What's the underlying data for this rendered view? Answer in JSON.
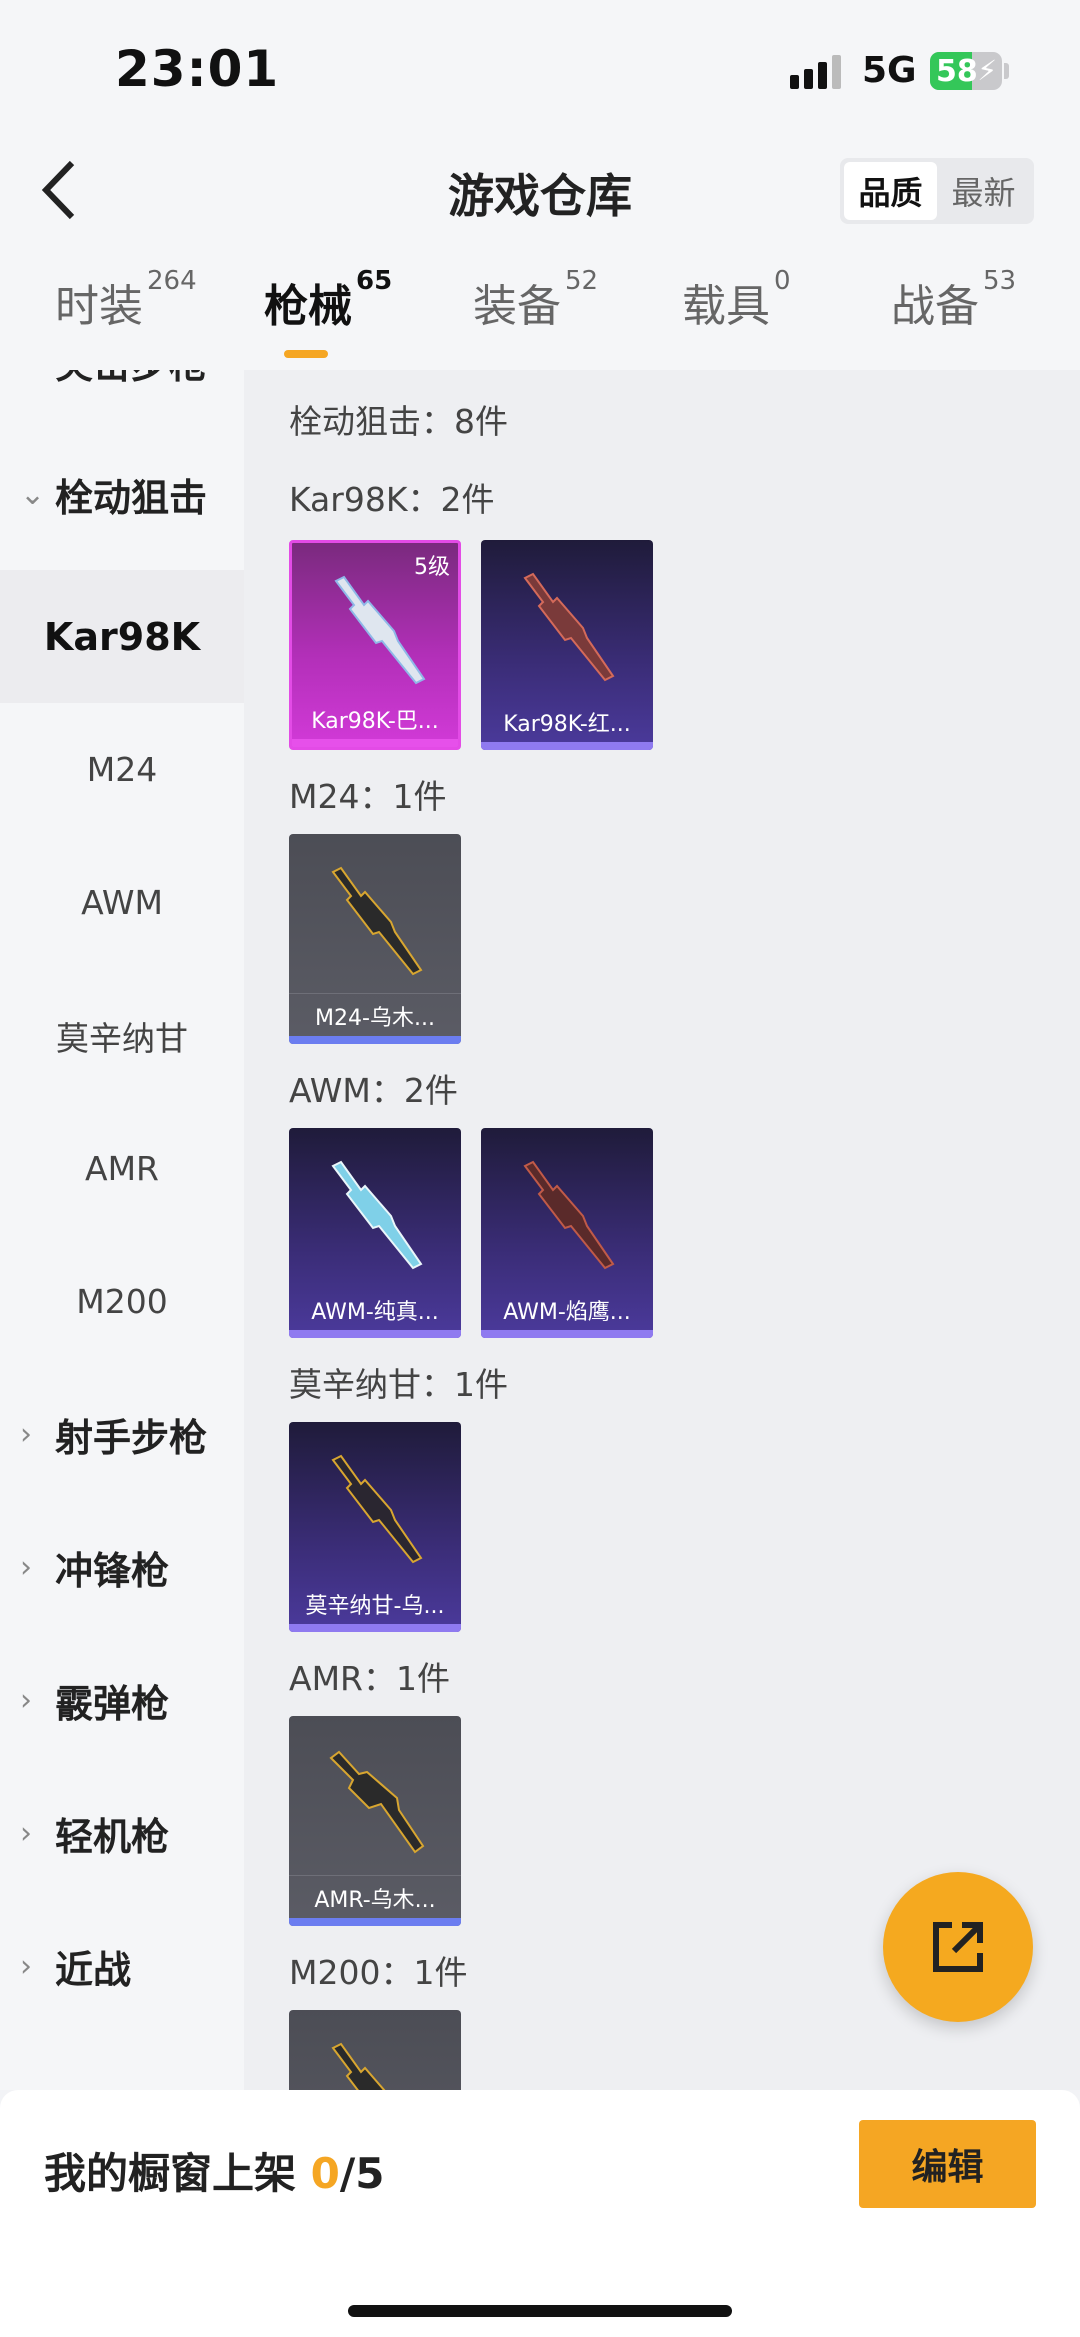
{
  "status_bar": {
    "time": "23:01",
    "network": "5G",
    "battery": "58"
  },
  "header": {
    "title": "游戏仓库",
    "sort_options": [
      "品质",
      "最新"
    ],
    "tabs": [
      {
        "label": "时装",
        "count": "264"
      },
      {
        "label": "枪械",
        "count": "65"
      },
      {
        "label": "装备",
        "count": "52"
      },
      {
        "label": "载具",
        "count": "0"
      },
      {
        "label": "战备",
        "count": "53"
      }
    ]
  },
  "sidebar": {
    "items": [
      {
        "label": "突击步枪",
        "type": "group"
      },
      {
        "label": "栓动狙击",
        "type": "group-open"
      },
      {
        "label": "Kar98K",
        "type": "sub-selected"
      },
      {
        "label": "M24",
        "type": "sub"
      },
      {
        "label": "AWM",
        "type": "sub"
      },
      {
        "label": "莫辛纳甘",
        "type": "sub"
      },
      {
        "label": "AMR",
        "type": "sub"
      },
      {
        "label": "M200",
        "type": "sub"
      },
      {
        "label": "射手步枪",
        "type": "group"
      },
      {
        "label": "冲锋枪",
        "type": "group"
      },
      {
        "label": "霰弹枪",
        "type": "group"
      },
      {
        "label": "轻机枪",
        "type": "group"
      },
      {
        "label": "近战",
        "type": "group"
      }
    ]
  },
  "content": {
    "summary": "栓动狙击：8件",
    "sections": [
      {
        "label": "Kar98K：2件",
        "items": [
          {
            "name": "Kar98K-巴...",
            "level": "5级"
          },
          {
            "name": "Kar98K-红..."
          }
        ]
      },
      {
        "label": "M24：1件",
        "items": [
          {
            "name": "M24-乌木..."
          }
        ]
      },
      {
        "label": "AWM：2件",
        "items": [
          {
            "name": "AWM-纯真..."
          },
          {
            "name": "AWM-焰鹰..."
          }
        ]
      },
      {
        "label": "莫辛纳甘：1件",
        "items": [
          {
            "name": "莫辛纳甘-乌..."
          }
        ]
      },
      {
        "label": "AMR：1件",
        "items": [
          {
            "name": "AMR-乌木..."
          }
        ]
      },
      {
        "label": "M200：1件",
        "items": []
      }
    ]
  },
  "bottom_bar": {
    "label": "我的橱窗上架 ",
    "count": "0",
    "total": "/5",
    "edit_label": "编辑"
  },
  "colors": {
    "accent": "#f5a623",
    "purple_card": "#3b2d78",
    "pink_card": "#c232c8",
    "gray_card": "#54555e"
  }
}
